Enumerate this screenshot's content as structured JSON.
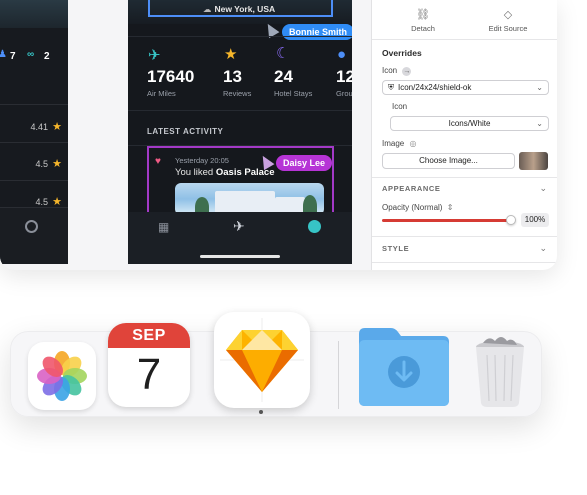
{
  "left_artboard": {
    "stats": [
      "7",
      "2"
    ],
    "ratings": [
      "4.41",
      "4.5",
      "4.5"
    ]
  },
  "phone": {
    "location": "New York, USA",
    "cursor_labels": {
      "top": "Bonnie Smith",
      "activity": "Daisy Lee"
    },
    "stats": [
      {
        "icon": "airplane-icon",
        "value": "17640",
        "label": "Air Miles",
        "color": "#37c4c6"
      },
      {
        "icon": "star-icon",
        "value": "13",
        "label": "Reviews",
        "color": "#f6b62b"
      },
      {
        "icon": "moon-icon",
        "value": "24",
        "label": "Hotel Stays",
        "color": "#8a6cf5"
      },
      {
        "icon": "group-icon",
        "value": "12",
        "label": "Grou",
        "color": "#4d8ef7"
      }
    ],
    "section_title": "LATEST ACTIVITY",
    "activity": {
      "time": "Yesterday 20:05",
      "text_prefix": "You liked ",
      "place": "Oasis Palace"
    }
  },
  "inspector": {
    "actions": [
      {
        "label": "Detach",
        "icon": "detach-icon"
      },
      {
        "label": "Edit Source",
        "icon": "diamond-icon"
      }
    ],
    "overrides_title": "Overrides",
    "icon_label": "Icon",
    "icon_value": "Icon/24x24/shield-ok",
    "nested_icon_label": "Icon",
    "nested_icon_value": "Icons/White",
    "image_label": "Image",
    "choose_image": "Choose Image...",
    "appearance_title": "APPEARANCE",
    "opacity_label": "Opacity (Normal)",
    "opacity_value": "100%",
    "opacity_fraction": 1.0,
    "style_title": "STYLE"
  },
  "dock": {
    "apps": [
      {
        "name": "Photos",
        "icon": "photos-icon"
      },
      {
        "name": "Calendar",
        "icon": "calendar-icon",
        "month": "SEP",
        "day": "7"
      },
      {
        "name": "Sketch",
        "icon": "sketch-icon",
        "running": true
      },
      {
        "name": "Downloads",
        "icon": "downloads-folder-icon"
      },
      {
        "name": "Trash",
        "icon": "trash-icon"
      }
    ]
  },
  "colors": {
    "selection_blue": "#4d8ef7",
    "selection_purple": "#a339c7",
    "slider_red": "#d63b34",
    "calendar_red": "#e0443a"
  }
}
